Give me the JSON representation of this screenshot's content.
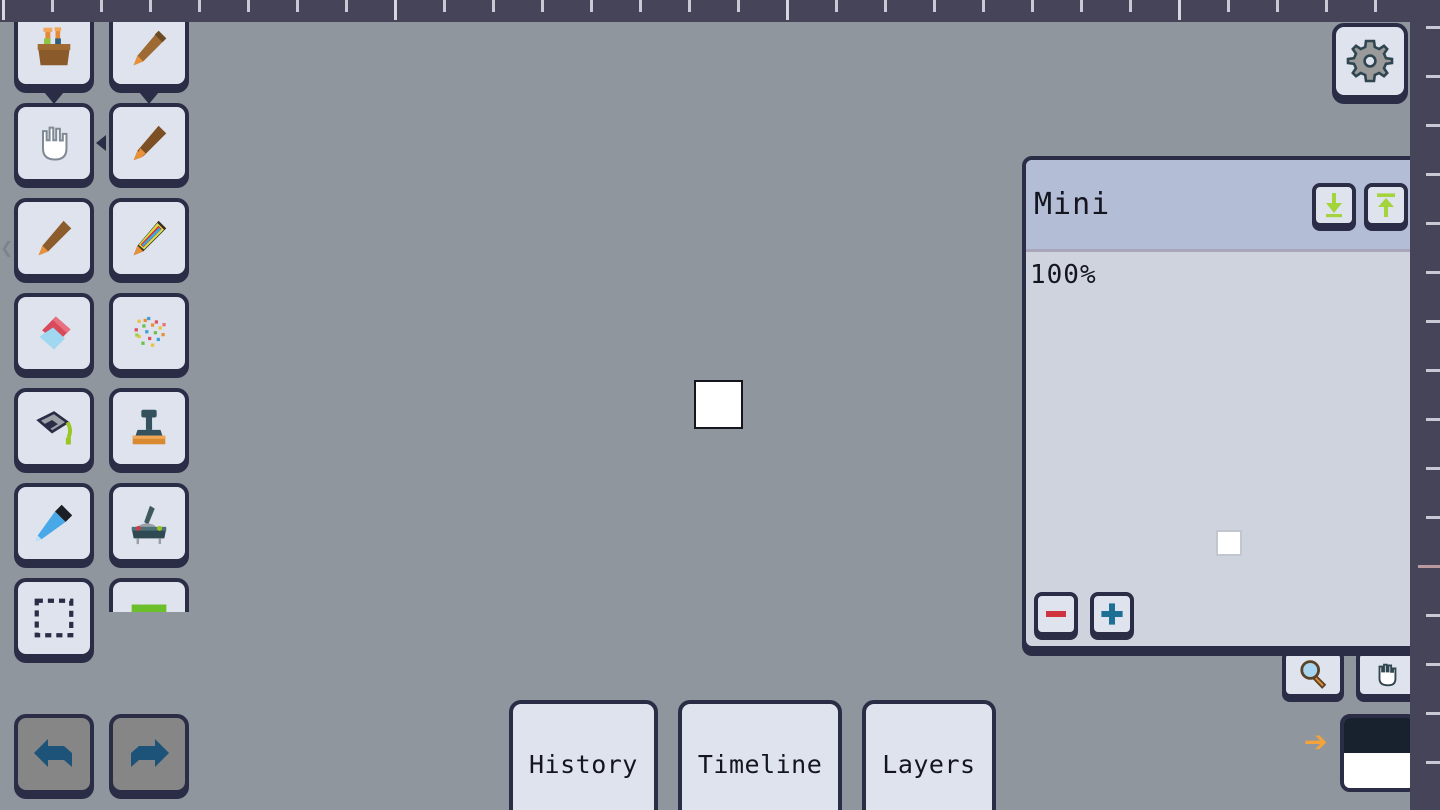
{
  "app": {
    "background_color": "#8f969e",
    "accent_color": "#2b2c46",
    "panel_color": "#dfe3ee"
  },
  "rulers": {
    "top": {
      "name": "horizontal-ruler",
      "tick_count": 29,
      "major_every": 8
    },
    "right": {
      "name": "vertical-ruler",
      "tick_count": 17,
      "major_index": 11
    }
  },
  "canvas": {
    "artboard_label": "",
    "artboard_color": "#ffffff",
    "artboard_border": "#14151f"
  },
  "toolbar": {
    "name": "tool-palette",
    "tools": [
      {
        "id": "toolbox",
        "label": "Toolbox",
        "icon": "toolbox-icon",
        "selected": true,
        "selection_marker": "down"
      },
      {
        "id": "pencil",
        "label": "Pencil",
        "icon": "pencil-icon",
        "selected": true,
        "selection_marker": "down"
      },
      {
        "id": "hand",
        "label": "Hand",
        "icon": "hand-icon",
        "selected": false,
        "selection_marker": "none"
      },
      {
        "id": "brush",
        "label": "Brush",
        "icon": "brush-icon",
        "selected": true,
        "selection_marker": "right"
      },
      {
        "id": "marker",
        "label": "Marker",
        "icon": "marker-icon",
        "selected": false,
        "selection_marker": "none"
      },
      {
        "id": "rainbow-pen",
        "label": "Rainbow Pen",
        "icon": "rainbow-pen-icon",
        "selected": false,
        "selection_marker": "none"
      },
      {
        "id": "eraser",
        "label": "Eraser",
        "icon": "eraser-icon",
        "selected": false,
        "selection_marker": "none"
      },
      {
        "id": "spray",
        "label": "Spray",
        "icon": "spray-icon",
        "selected": false,
        "selection_marker": "none"
      },
      {
        "id": "fill",
        "label": "Fill",
        "icon": "paint-bucket-icon",
        "selected": false,
        "selection_marker": "none"
      },
      {
        "id": "stamp",
        "label": "Stamp",
        "icon": "stamp-icon",
        "selected": false,
        "selection_marker": "none"
      },
      {
        "id": "eyedropper",
        "label": "Eyedropper",
        "icon": "eyedropper-icon",
        "selected": false,
        "selection_marker": "none"
      },
      {
        "id": "smudge",
        "label": "Smudge",
        "icon": "smudge-tool-icon",
        "selected": false,
        "selection_marker": "none"
      },
      {
        "id": "select",
        "label": "Select",
        "icon": "marquee-select-icon",
        "selected": false,
        "selection_marker": "none"
      },
      {
        "id": "shapes",
        "label": "Shapes",
        "icon": "shapes-icon",
        "selected": false,
        "selection_marker": "none"
      }
    ]
  },
  "history_controls": {
    "undo": {
      "label": "Undo",
      "icon": "undo-arrow-icon",
      "enabled": false
    },
    "redo": {
      "label": "Redo",
      "icon": "redo-arrow-icon",
      "enabled": false
    }
  },
  "settings": {
    "label": "Settings",
    "icon": "gear-icon"
  },
  "bottom_tabs": [
    {
      "id": "history",
      "label": "History",
      "active": false
    },
    {
      "id": "timeline",
      "label": "Timeline",
      "active": false
    },
    {
      "id": "layers",
      "label": "Layers",
      "active": false
    }
  ],
  "mini_panel": {
    "title": "Mini",
    "zoom_label": "100%",
    "title_buttons": [
      {
        "id": "dock-down",
        "label": "Dock Down",
        "icon": "arrow-down-dock-icon",
        "color": "#a3d43b"
      },
      {
        "id": "collapse-up",
        "label": "Collapse",
        "icon": "arrow-up-collapse-icon",
        "color": "#a3d43b"
      }
    ],
    "zoom_out": {
      "label": "Zoom Out",
      "icon": "minus-icon",
      "color": "#cf3340"
    },
    "zoom_in": {
      "label": "Zoom In",
      "icon": "plus-icon",
      "color": "#1d6f93"
    },
    "preview": {
      "name": "minimap-preview",
      "color": "#ffffff"
    }
  },
  "view_controls": [
    {
      "id": "zoom-tool",
      "label": "Zoom Tool",
      "icon": "magnifier-icon"
    },
    {
      "id": "pan-tool",
      "label": "Pan Tool",
      "icon": "hand-pan-icon"
    }
  ],
  "color_picker": {
    "swap_arrow": {
      "label": "Swap Colors",
      "icon": "arrow-right-icon",
      "color": "#f2a33c"
    },
    "primary_color": "#18222e",
    "secondary_color": "#ffffff"
  },
  "left_edge": {
    "icon": "collapse-handle-icon"
  }
}
